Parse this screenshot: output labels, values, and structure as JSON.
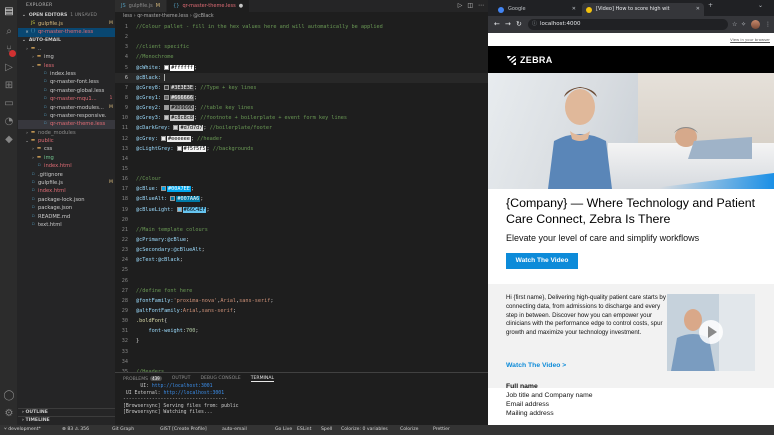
{
  "vscode": {
    "explorer_title": "EXPLORER",
    "open_editors": {
      "label": "OPEN EDITORS",
      "badge": "1 UNSAVED"
    },
    "open_files": [
      {
        "name": "gulpfile.js",
        "badge": "M",
        "icon": "js-icon",
        "color": "#d7ba7d",
        "selected": false
      },
      {
        "name": "qr-master-theme.less",
        "badge": "",
        "icon": "less-icon",
        "color": "#e06c75",
        "selected": true
      }
    ],
    "project": "AUTO-EMAIL",
    "tree": [
      {
        "name": "..",
        "depth": 1,
        "type": "folder",
        "color": "#cccccc",
        "badge": ""
      },
      {
        "name": "img",
        "depth": 2,
        "type": "folder",
        "color": "#cccccc",
        "badge": ""
      },
      {
        "name": "less",
        "depth": 2,
        "type": "folder-open",
        "color": "#e06c75",
        "badge": ""
      },
      {
        "name": "index.less",
        "depth": 3,
        "type": "file",
        "color": "#cccccc",
        "badge": ""
      },
      {
        "name": "qr-master-font.less",
        "depth": 3,
        "type": "file",
        "color": "#cccccc",
        "badge": ""
      },
      {
        "name": "qr-master-global.less",
        "depth": 3,
        "type": "file",
        "color": "#cccccc",
        "badge": ""
      },
      {
        "name": "qr-master-mqu1...",
        "depth": 3,
        "type": "file",
        "color": "#e06c75",
        "badge": "1"
      },
      {
        "name": "qr-master-modules...",
        "depth": 3,
        "type": "file",
        "color": "#cccccc",
        "badge": "M"
      },
      {
        "name": "qr-master-responsive.less",
        "depth": 3,
        "type": "file",
        "color": "#cccccc",
        "badge": ""
      },
      {
        "name": "qr-master-theme.less",
        "depth": 3,
        "type": "file",
        "color": "#e06c75",
        "badge": "",
        "selected": true
      },
      {
        "name": "node_modules",
        "depth": 1,
        "type": "folder",
        "color": "#8b8b8b",
        "badge": ""
      },
      {
        "name": "public",
        "depth": 1,
        "type": "folder-open",
        "color": "#e06c75",
        "badge": ""
      },
      {
        "name": "css",
        "depth": 2,
        "type": "folder",
        "color": "#cccccc",
        "badge": ""
      },
      {
        "name": "img",
        "depth": 2,
        "type": "folder",
        "color": "#73c991",
        "badge": ""
      },
      {
        "name": "index.html",
        "depth": 2,
        "type": "file",
        "color": "#e06c75",
        "badge": ""
      },
      {
        "name": ".gitignore",
        "depth": 1,
        "type": "file",
        "color": "#cccccc",
        "badge": ""
      },
      {
        "name": "gulpfile.js",
        "depth": 1,
        "type": "file",
        "color": "#cccccc",
        "badge": "M"
      },
      {
        "name": "index.html",
        "depth": 1,
        "type": "file",
        "color": "#e06c75",
        "badge": ""
      },
      {
        "name": "package-lock.json",
        "depth": 1,
        "type": "file",
        "color": "#cccccc",
        "badge": ""
      },
      {
        "name": "package.json",
        "depth": 1,
        "type": "file",
        "color": "#cccccc",
        "badge": ""
      },
      {
        "name": "README.md",
        "depth": 1,
        "type": "file",
        "color": "#cccccc",
        "badge": ""
      },
      {
        "name": "text.html",
        "depth": 1,
        "type": "file",
        "color": "#cccccc",
        "badge": ""
      }
    ],
    "outline_label": "OUTLINE",
    "timeline_label": "TIMELINE",
    "tabs": [
      {
        "label": "gulpfile.js",
        "badge": "M",
        "active": false
      },
      {
        "label": "qr-master-theme.less",
        "badge": "",
        "active": true
      }
    ],
    "breadcrumb": "less › qr-master-theme.less › @cBlack",
    "code_lines": [
      {
        "n": "1",
        "parts": [
          [
            "t-com",
            "//Colour pallet - fill in the hex values here and will automatically be applied"
          ]
        ]
      },
      {
        "n": "2",
        "parts": []
      },
      {
        "n": "3",
        "parts": [
          [
            "t-com",
            "//client specific"
          ]
        ]
      },
      {
        "n": "4",
        "parts": [
          [
            "t-com",
            "//Monochrome"
          ]
        ]
      },
      {
        "n": "5",
        "parts": [
          [
            "t-var",
            "@cWhite: "
          ],
          [
            "swatch",
            "#ffffff"
          ],
          [
            "t-val",
            "#ffffff"
          ],
          [
            "t-plain",
            ";"
          ]
        ]
      },
      {
        "n": "6",
        "parts": [
          [
            "t-var",
            "@cBlack: "
          ],
          [
            "cursor",
            ""
          ]
        ],
        "current": true
      },
      {
        "n": "7",
        "parts": [
          [
            "t-var",
            "@cGrey8: "
          ],
          [
            "swatch",
            "#3E3E3E"
          ],
          [
            "t-val",
            "#3E3E3E"
          ],
          [
            "t-plain",
            "; "
          ],
          [
            "t-com",
            "//Type + key lines"
          ]
        ]
      },
      {
        "n": "8",
        "parts": [
          [
            "t-var",
            "@cGrey1: "
          ],
          [
            "swatch",
            "#666666"
          ],
          [
            "t-val",
            "#666666"
          ],
          [
            "t-plain",
            ";"
          ]
        ]
      },
      {
        "n": "9",
        "parts": [
          [
            "t-var",
            "@cGrey2: "
          ],
          [
            "swatch",
            "#9D9D9D"
          ],
          [
            "t-val",
            "#9D9D9D"
          ],
          [
            "t-plain",
            "; "
          ],
          [
            "t-com",
            "//table key lines"
          ]
        ]
      },
      {
        "n": "10",
        "parts": [
          [
            "t-var",
            "@cGrey3: "
          ],
          [
            "swatch",
            "#c8c8c8"
          ],
          [
            "t-val",
            "#c8c8c8"
          ],
          [
            "t-plain",
            "; "
          ],
          [
            "t-com",
            "//footnote + boilerplate + event form key lines"
          ]
        ]
      },
      {
        "n": "11",
        "parts": [
          [
            "t-var",
            "@cDarkGrey: "
          ],
          [
            "swatch",
            "#d7d7d7"
          ],
          [
            "t-val",
            "#d7d7d7"
          ],
          [
            "t-plain",
            "; "
          ],
          [
            "t-com",
            "//boilerplate/footer"
          ]
        ]
      },
      {
        "n": "12",
        "parts": [
          [
            "t-var",
            "@cGrey: "
          ],
          [
            "swatch",
            "#eeeeee"
          ],
          [
            "t-val",
            "#eeeeee"
          ],
          [
            "t-plain",
            "; "
          ],
          [
            "t-com",
            "//header"
          ]
        ]
      },
      {
        "n": "13",
        "parts": [
          [
            "t-var",
            "@cLightGrey: "
          ],
          [
            "swatch",
            "#f5f5f5"
          ],
          [
            "t-val",
            "#f5f5f5"
          ],
          [
            "t-plain",
            "; "
          ],
          [
            "t-com",
            "//backgrounds"
          ]
        ]
      },
      {
        "n": "14",
        "parts": []
      },
      {
        "n": "15",
        "parts": []
      },
      {
        "n": "16",
        "parts": [
          [
            "t-com",
            "//Colour"
          ]
        ]
      },
      {
        "n": "17",
        "parts": [
          [
            "t-var",
            "@cBlue: "
          ],
          [
            "swatch",
            "#00A7EE"
          ],
          [
            "t-val",
            "#00A7EE"
          ],
          [
            "t-plain",
            ";"
          ]
        ]
      },
      {
        "n": "18",
        "parts": [
          [
            "t-var",
            "@cBlueAlt: "
          ],
          [
            "swatch",
            "#007AA6"
          ],
          [
            "t-val",
            "#007AA6"
          ],
          [
            "t-plain",
            ";"
          ]
        ]
      },
      {
        "n": "19",
        "parts": [
          [
            "t-var",
            "@cBlueLight: "
          ],
          [
            "swatch",
            "#66C4EF"
          ],
          [
            "t-val",
            "#66C4EF"
          ],
          [
            "t-plain",
            ";"
          ]
        ]
      },
      {
        "n": "20",
        "parts": []
      },
      {
        "n": "21",
        "parts": [
          [
            "t-com",
            "//Main template colours"
          ]
        ]
      },
      {
        "n": "22",
        "parts": [
          [
            "t-var",
            "@cPrimary:"
          ],
          [
            "t-var",
            "@cBlue"
          ],
          [
            "t-plain",
            ";"
          ]
        ]
      },
      {
        "n": "23",
        "parts": [
          [
            "t-var",
            "@cSecondary:"
          ],
          [
            "t-var",
            "@cBlueAlt"
          ],
          [
            "t-plain",
            ";"
          ]
        ]
      },
      {
        "n": "24",
        "parts": [
          [
            "t-var",
            "@cText:"
          ],
          [
            "t-var",
            "@cBlack"
          ],
          [
            "t-plain",
            ";"
          ]
        ]
      },
      {
        "n": "25",
        "parts": []
      },
      {
        "n": "26",
        "parts": []
      },
      {
        "n": "27",
        "parts": [
          [
            "t-com",
            "//define font here"
          ]
        ]
      },
      {
        "n": "28",
        "parts": [
          [
            "t-var",
            "@fontFamily:"
          ],
          [
            "t-val",
            "'proxima-nova'"
          ],
          [
            "t-plain",
            ","
          ],
          [
            "t-val",
            "Arial"
          ],
          [
            "t-plain",
            ","
          ],
          [
            "t-val",
            "sans-serif"
          ],
          [
            "t-plain",
            ";"
          ]
        ]
      },
      {
        "n": "29",
        "parts": [
          [
            "t-var",
            "@altFontFamily:"
          ],
          [
            "t-val",
            "Arial"
          ],
          [
            "t-plain",
            ","
          ],
          [
            "t-val",
            "sans-serif"
          ],
          [
            "t-plain",
            ";"
          ]
        ]
      },
      {
        "n": "30",
        "parts": [
          [
            "t-fn",
            ".boldFont"
          ],
          [
            "t-plain",
            "{"
          ]
        ]
      },
      {
        "n": "31",
        "parts": [
          [
            "t-plain",
            "    "
          ],
          [
            "t-var",
            "font-weight"
          ],
          [
            "t-plain",
            ":"
          ],
          [
            "t-num",
            "700"
          ],
          [
            "t-plain",
            ";"
          ]
        ]
      },
      {
        "n": "32",
        "parts": [
          [
            "t-plain",
            "}"
          ]
        ]
      },
      {
        "n": "33",
        "parts": []
      },
      {
        "n": "34",
        "parts": []
      },
      {
        "n": "35",
        "parts": [
          [
            "t-com",
            "//Headers"
          ]
        ]
      }
    ],
    "panel_tabs": [
      "PROBLEMS",
      "OUTPUT",
      "DEBUG CONSOLE",
      "TERMINAL"
    ],
    "problems_count": "439",
    "terminal_lines": [
      [
        "      UI: ",
        "http://localhost:3001"
      ],
      [
        " UI External: ",
        "http://localhost:3001"
      ],
      [
        "------------------------------------",
        ""
      ],
      [
        "[Browsersync] Serving files from: public",
        ""
      ],
      [
        "[Browsersync] Watching files...",
        ""
      ]
    ],
    "status": {
      "branch": "development*",
      "errors": "83",
      "warnings": "356",
      "git_graph": "Git Graph",
      "gist": "GIST [Create Profile]",
      "project": "auto-email",
      "go_live": "Go Live",
      "eslint": "ESLint",
      "spell": "Spell",
      "colorize_vars": "Colorize: 0 variables",
      "colorize": "Colorize",
      "prettier": "Prettier"
    }
  },
  "chrome": {
    "tabs": [
      {
        "label": "Google",
        "active": false,
        "color": "#4285f4"
      },
      {
        "label": "[Video] How to score high wit",
        "active": true,
        "color": "#f4c20d"
      }
    ],
    "url": "localhost:4000",
    "page": {
      "view_in_browser": "View in your browser",
      "logo_text": "ZEBRA",
      "headline": "{Company} — Where Technology and Patient Care Connect, Zebra Is There",
      "subhead": "Elevate your level of care and simplify workflows",
      "cta": "Watch The Video",
      "body": "Hi {first name}, Delivering high-quality patient care starts by connecting data, from admissions to discharge and every step in between. Discover how you can empower your clinicians with the performance edge to control costs, spur growth and maximize your technology investment.",
      "watch_link": "Watch The Video >",
      "sig_name": "Full name",
      "sig_lines": [
        "Job title and Company name",
        "Email address",
        "Mailing address"
      ],
      "accent": "#0d8bd9"
    }
  }
}
